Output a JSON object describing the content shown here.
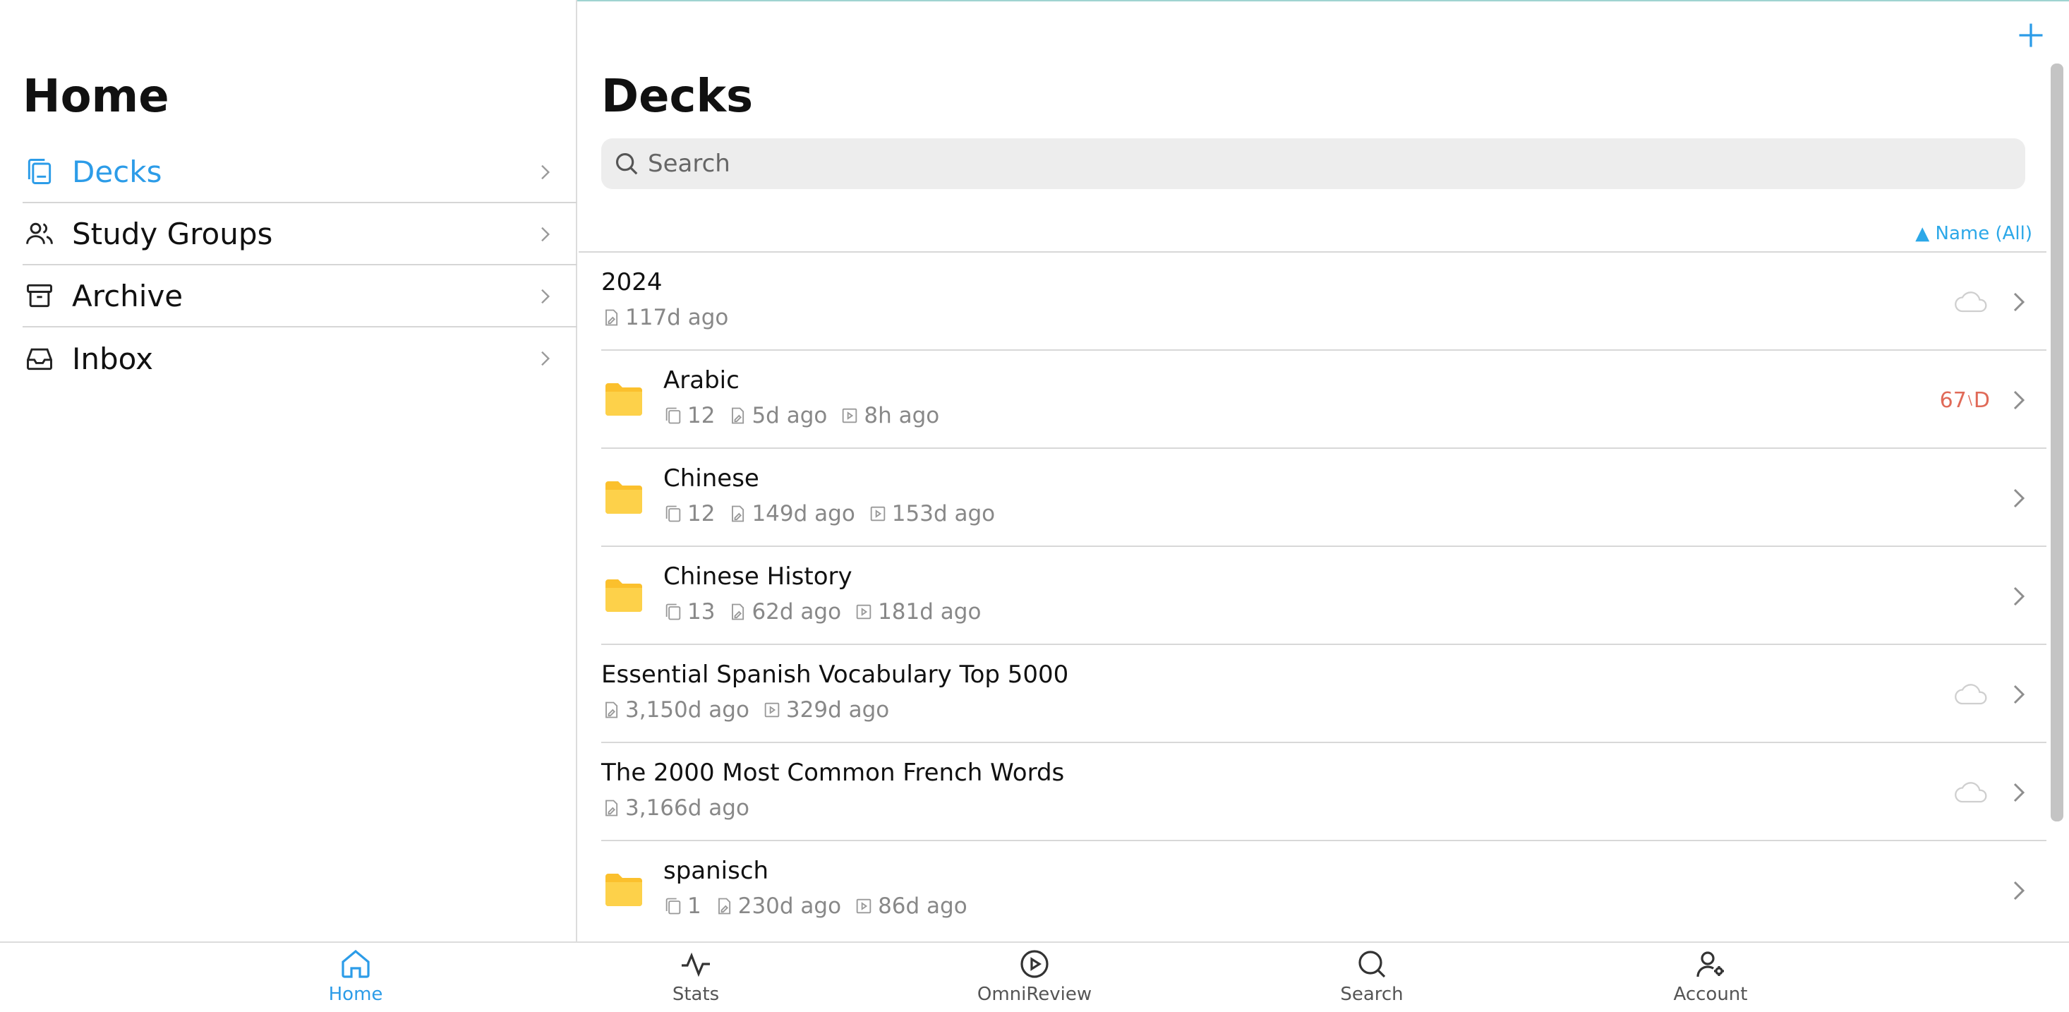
{
  "sidebar": {
    "title": "Home",
    "items": [
      {
        "label": "Decks",
        "icon": "decks-icon",
        "active": true
      },
      {
        "label": "Study Groups",
        "icon": "users-icon"
      },
      {
        "label": "Archive",
        "icon": "archive-icon"
      },
      {
        "label": "Inbox",
        "icon": "inbox-icon"
      }
    ]
  },
  "main": {
    "title": "Decks",
    "search_placeholder": "Search",
    "sort_label": "▲ Name (All)",
    "decks": [
      {
        "name": "2024",
        "folder": false,
        "cards": "",
        "edited": "117d ago",
        "reviewed": "",
        "cloud": true,
        "due": ""
      },
      {
        "name": "Arabic",
        "folder": true,
        "cards": "12",
        "edited": "5d ago",
        "reviewed": "8h ago",
        "cloud": false,
        "due_num": "67",
        "due_sep": "\\",
        "due_suffix": "D"
      },
      {
        "name": "Chinese",
        "folder": true,
        "cards": "12",
        "edited": "149d ago",
        "reviewed": "153d ago",
        "cloud": false
      },
      {
        "name": "Chinese History",
        "folder": true,
        "cards": "13",
        "edited": "62d ago",
        "reviewed": "181d ago",
        "cloud": false
      },
      {
        "name": "Essential Spanish Vocabulary Top 5000",
        "folder": false,
        "cards": "",
        "edited": "3,150d ago",
        "reviewed": "329d ago",
        "cloud": true
      },
      {
        "name": "The 2000 Most Common French Words",
        "folder": false,
        "cards": "",
        "edited": "3,166d ago",
        "reviewed": "",
        "cloud": true
      },
      {
        "name": "spanisch",
        "folder": true,
        "cards": "1",
        "edited": "230d ago",
        "reviewed": "86d ago",
        "cloud": false
      }
    ]
  },
  "tabbar": {
    "items": [
      {
        "label": "Home",
        "icon": "home-icon",
        "active": true
      },
      {
        "label": "Stats",
        "icon": "stats-icon"
      },
      {
        "label": "OmniReview",
        "icon": "play-icon"
      },
      {
        "label": "Search",
        "icon": "search-icon"
      },
      {
        "label": "Account",
        "icon": "account-icon"
      }
    ]
  },
  "colors": {
    "accent": "#2c9ce8",
    "folder": "#fbc02d",
    "due": "#e06a58"
  }
}
